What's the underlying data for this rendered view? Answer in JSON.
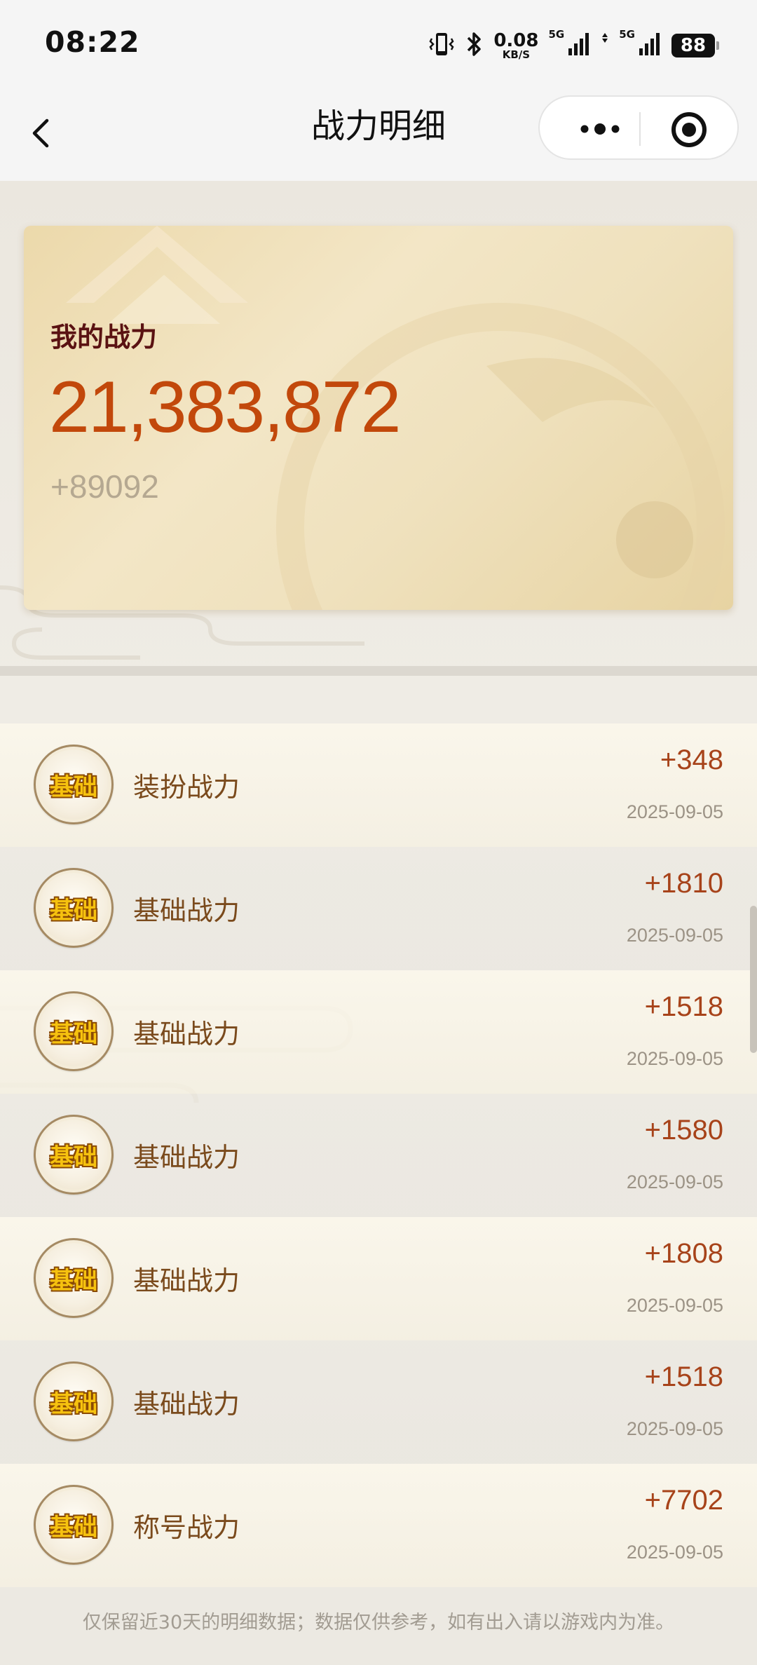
{
  "status_bar": {
    "time": "08:22",
    "net_speed_value": "0.08",
    "net_speed_unit": "KB/S",
    "sig1_label": "5G",
    "sig2_label": "5G",
    "battery": "88"
  },
  "nav": {
    "title": "战力明细"
  },
  "summary": {
    "label": "我的战力",
    "value": "21,383,872",
    "delta": "+89092"
  },
  "records": [
    {
      "badge": "基础",
      "name": "装扮战力",
      "amount": "+348",
      "date": "2025-09-05"
    },
    {
      "badge": "基础",
      "name": "基础战力",
      "amount": "+1810",
      "date": "2025-09-05"
    },
    {
      "badge": "基础",
      "name": "基础战力",
      "amount": "+1518",
      "date": "2025-09-05"
    },
    {
      "badge": "基础",
      "name": "基础战力",
      "amount": "+1580",
      "date": "2025-09-05"
    },
    {
      "badge": "基础",
      "name": "基础战力",
      "amount": "+1808",
      "date": "2025-09-05"
    },
    {
      "badge": "基础",
      "name": "基础战力",
      "amount": "+1518",
      "date": "2025-09-05"
    },
    {
      "badge": "基础",
      "name": "称号战力",
      "amount": "+7702",
      "date": "2025-09-05"
    }
  ],
  "footer_note": "仅保留近30天的明细数据；数据仅供参考，如有出入请以游戏内为准。",
  "colors": {
    "accent_value": "#c2480b",
    "amount": "#a7431a",
    "record_name": "#7a4a1c",
    "card_label": "#5a1212"
  }
}
